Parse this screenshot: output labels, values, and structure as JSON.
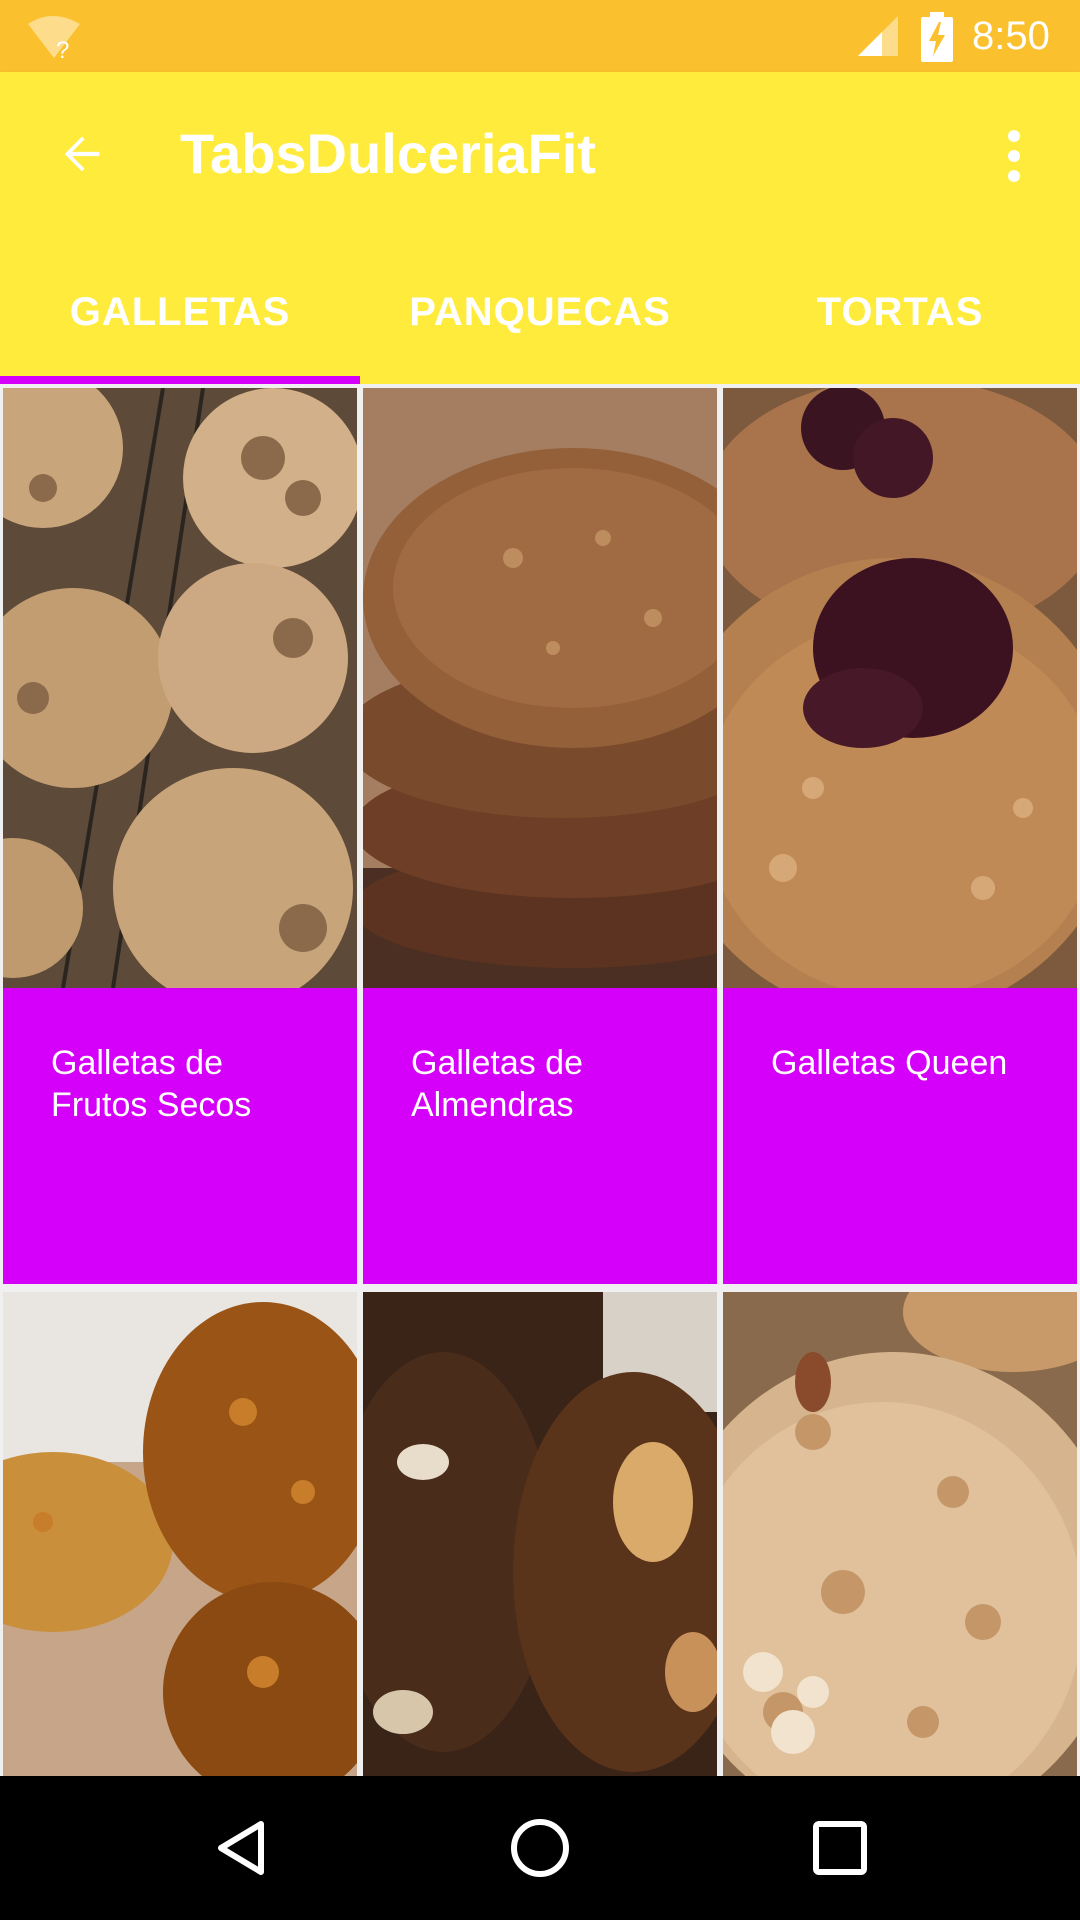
{
  "status_bar": {
    "time": "8:50",
    "wifi_icon": "wifi-unknown-icon",
    "signal_icon": "signal-icon",
    "battery_icon": "battery-charging-icon",
    "color": "#fbc02d"
  },
  "app_bar": {
    "title": "TabsDulceriaFit",
    "back_icon": "arrow-back-icon",
    "overflow_icon": "more-vert-icon",
    "color": "#ffeb3b"
  },
  "tabs": [
    {
      "label": "GALLETAS",
      "selected": true
    },
    {
      "label": "PANQUECAS",
      "selected": false
    },
    {
      "label": "TORTAS",
      "selected": false
    }
  ],
  "accent_color": "#d500f9",
  "cards": [
    {
      "caption": "Galletas de\nFrutos Secos",
      "image": "walnut-cookies-photo"
    },
    {
      "caption": "Galletas de\nAlmendras",
      "image": "almond-cookies-photo"
    },
    {
      "caption": "Galletas Queen",
      "image": "jam-oat-cookies-photo"
    },
    {
      "caption": "",
      "image": "pumpkin-cookies-photo"
    },
    {
      "caption": "",
      "image": "chocolate-nut-cookies-photo"
    },
    {
      "caption": "",
      "image": "oat-cookies-photo"
    }
  ],
  "nav_bar": {
    "back_icon": "nav-back-icon",
    "home_icon": "nav-home-icon",
    "recents_icon": "nav-recents-icon"
  }
}
